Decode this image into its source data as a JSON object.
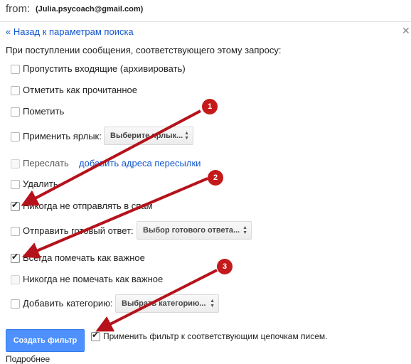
{
  "header": {
    "from_label": "from:",
    "from_value": "(Julia.psycoach@gmail.com)"
  },
  "nav": {
    "back_link": "« Назад к параметрам поиска",
    "close_icon": "close-icon"
  },
  "intro": "При поступлении сообщения, соответствующего этому запросу:",
  "options": {
    "skip_inbox": {
      "label": "Пропустить входящие (архивировать)",
      "checked": false
    },
    "mark_read": {
      "label": "Отметить как прочитанное",
      "checked": false
    },
    "star": {
      "label": "Пометить",
      "checked": false
    },
    "apply_label": {
      "label": "Применить ярлык:",
      "checked": false,
      "select": "Выберите ярлык..."
    },
    "forward": {
      "label": "Переслать",
      "checked": false,
      "disabled": true,
      "link": "добавить адреса пересылки"
    },
    "delete": {
      "label": "Удалить",
      "checked": false
    },
    "never_spam": {
      "label": "Никогда не отправлять в спам",
      "checked": true
    },
    "canned": {
      "label": "Отправить готовый ответ:",
      "checked": false,
      "select": "Выбор готового ответа..."
    },
    "always_important": {
      "label": "Всегда помечать как важное",
      "checked": true
    },
    "never_important": {
      "label": "Никогда не помечать как важное",
      "checked": false,
      "disabled": true
    },
    "category": {
      "label": "Добавить категорию:",
      "checked": false,
      "select": "Выбрать категорию..."
    }
  },
  "footer": {
    "create_button": "Создать фильтр",
    "apply_existing": {
      "label": "Применить фильтр к соответствующим цепочкам писем.",
      "checked": true
    },
    "cut_text": "Подробнее"
  },
  "annotations": {
    "badges": [
      "1",
      "2",
      "3"
    ],
    "arrow_color": "#b5121b"
  }
}
